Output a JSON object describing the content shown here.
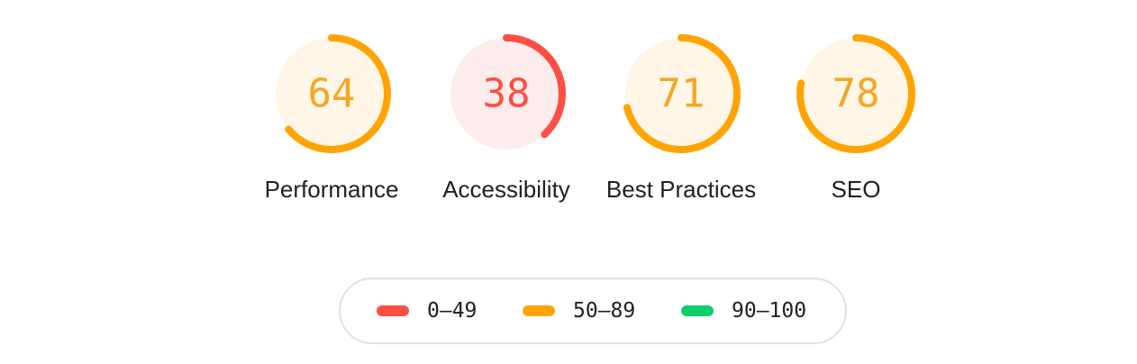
{
  "gauges": [
    {
      "label": "Performance",
      "score": "64",
      "fraction": 0.64,
      "band": "average"
    },
    {
      "label": "Accessibility",
      "score": "38",
      "fraction": 0.38,
      "band": "fail"
    },
    {
      "label": "Best Practices",
      "score": "71",
      "fraction": 0.71,
      "band": "average"
    },
    {
      "label": "SEO",
      "score": "78",
      "fraction": 0.78,
      "band": "average"
    }
  ],
  "colors": {
    "fail": {
      "stroke": "#ff4e42",
      "fill": "#fdecec",
      "text": "#ff4e42"
    },
    "average": {
      "stroke": "#ffa400",
      "fill": "#fff6e8",
      "text": "#f5a623"
    },
    "pass": {
      "stroke": "#0cce6b",
      "fill": "#e6f8ef",
      "text": "#0cce6b"
    },
    "legend_border": "#e0e0e0",
    "label_text": "#212121"
  },
  "legend": [
    {
      "range": "0–49",
      "band": "fail"
    },
    {
      "range": "50–89",
      "band": "average"
    },
    {
      "range": "90–100",
      "band": "pass"
    }
  ]
}
